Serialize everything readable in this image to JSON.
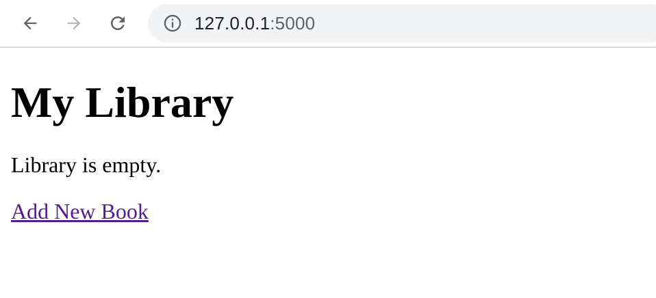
{
  "browser": {
    "url_host": "127.0.0.1",
    "url_port": ":5000",
    "icons": {
      "back": "arrow-left-icon",
      "forward": "arrow-right-icon",
      "reload": "reload-icon",
      "site_info": "info-circle-icon"
    },
    "forward_enabled": false
  },
  "page": {
    "title": "My Library",
    "empty_message": "Library is empty.",
    "add_link_label": "Add New Book",
    "link_color": "#551a8b"
  }
}
